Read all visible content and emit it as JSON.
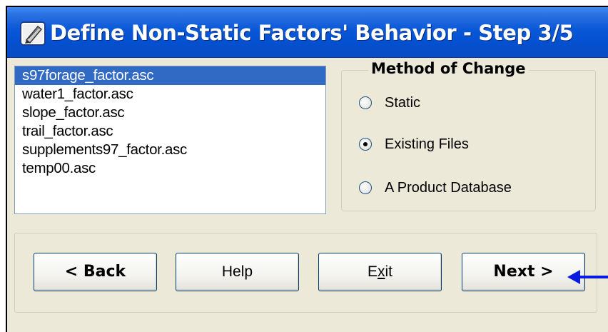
{
  "window": {
    "title": "Define Non-Static Factors' Behavior - Step 3/5",
    "title_color": "#0a58d8"
  },
  "file_list": {
    "items": [
      "s97forage_factor.asc",
      "water1_factor.asc",
      "slope_factor.asc",
      "trail_factor.asc",
      "supplements97_factor.asc",
      "temp00.asc"
    ],
    "selected_index": 0,
    "selected_color": "#316ac5"
  },
  "method_group": {
    "legend": "Method of Change",
    "options": [
      "Static",
      "Existing Files",
      "A Product Database"
    ],
    "selected": "Existing Files"
  },
  "buttons": {
    "back": "< Back",
    "help": "Help",
    "exit_pre": "E",
    "exit_mnemonic": "x",
    "exit_post": "it",
    "next": "Next >"
  },
  "annotation": {
    "arrow_color": "#0a1adf",
    "arrow_target": "Next >"
  }
}
